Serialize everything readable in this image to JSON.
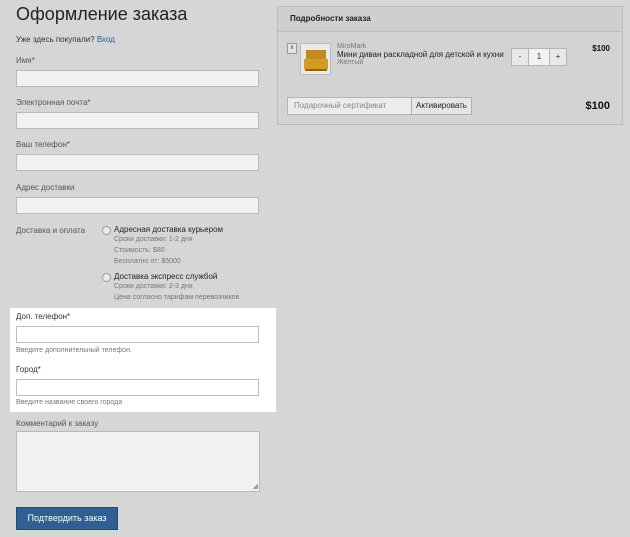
{
  "page": {
    "title": "Оформление заказа",
    "returning_text": "Уже здесь покупали?",
    "login_link": "Вход"
  },
  "form": {
    "name_label": "Имя*",
    "email_label": "Электронная почта*",
    "phone_label": "Ваш телефон*",
    "address_label": "Адрес доставки",
    "delivery_label": "Доставка и оплата",
    "delivery_options": [
      {
        "title": "Адресная доставка курьером",
        "lines": [
          "Сроки доставки: 1-2 дня",
          "Стоимость: $80",
          "Бесплатно от: $5000"
        ],
        "selected": false
      },
      {
        "title": "Доставка экспресс службой",
        "lines": [
          "Сроки доставки: 2-3 дня",
          "Цена согласно тарифам перевозчиков"
        ],
        "selected": false
      }
    ],
    "extra_phone_label": "Доп. телефон*",
    "extra_phone_hint": "Введите дополнительный телефон.",
    "city_label": "Город*",
    "city_hint": "Введите название своего города",
    "comment_label": "Комментарий к заказу",
    "submit_label": "Подтвердить заказ"
  },
  "order": {
    "heading": "Подробности заказа",
    "item": {
      "remove": "x",
      "brand": "MiroMark",
      "name": "Мини диван раскладной для детской и кухни",
      "variant": "Желтый",
      "qty_minus": "-",
      "qty": "1",
      "qty_plus": "+",
      "price": "$100"
    },
    "gift_placeholder": "Подарочный сертификат",
    "gift_button": "Активировать",
    "total": "$100"
  },
  "colors": {
    "primary_button": "#2f5f93",
    "link": "#1f5fa3",
    "overlay": "#d6d6d6",
    "highlight": "#ffffff"
  }
}
